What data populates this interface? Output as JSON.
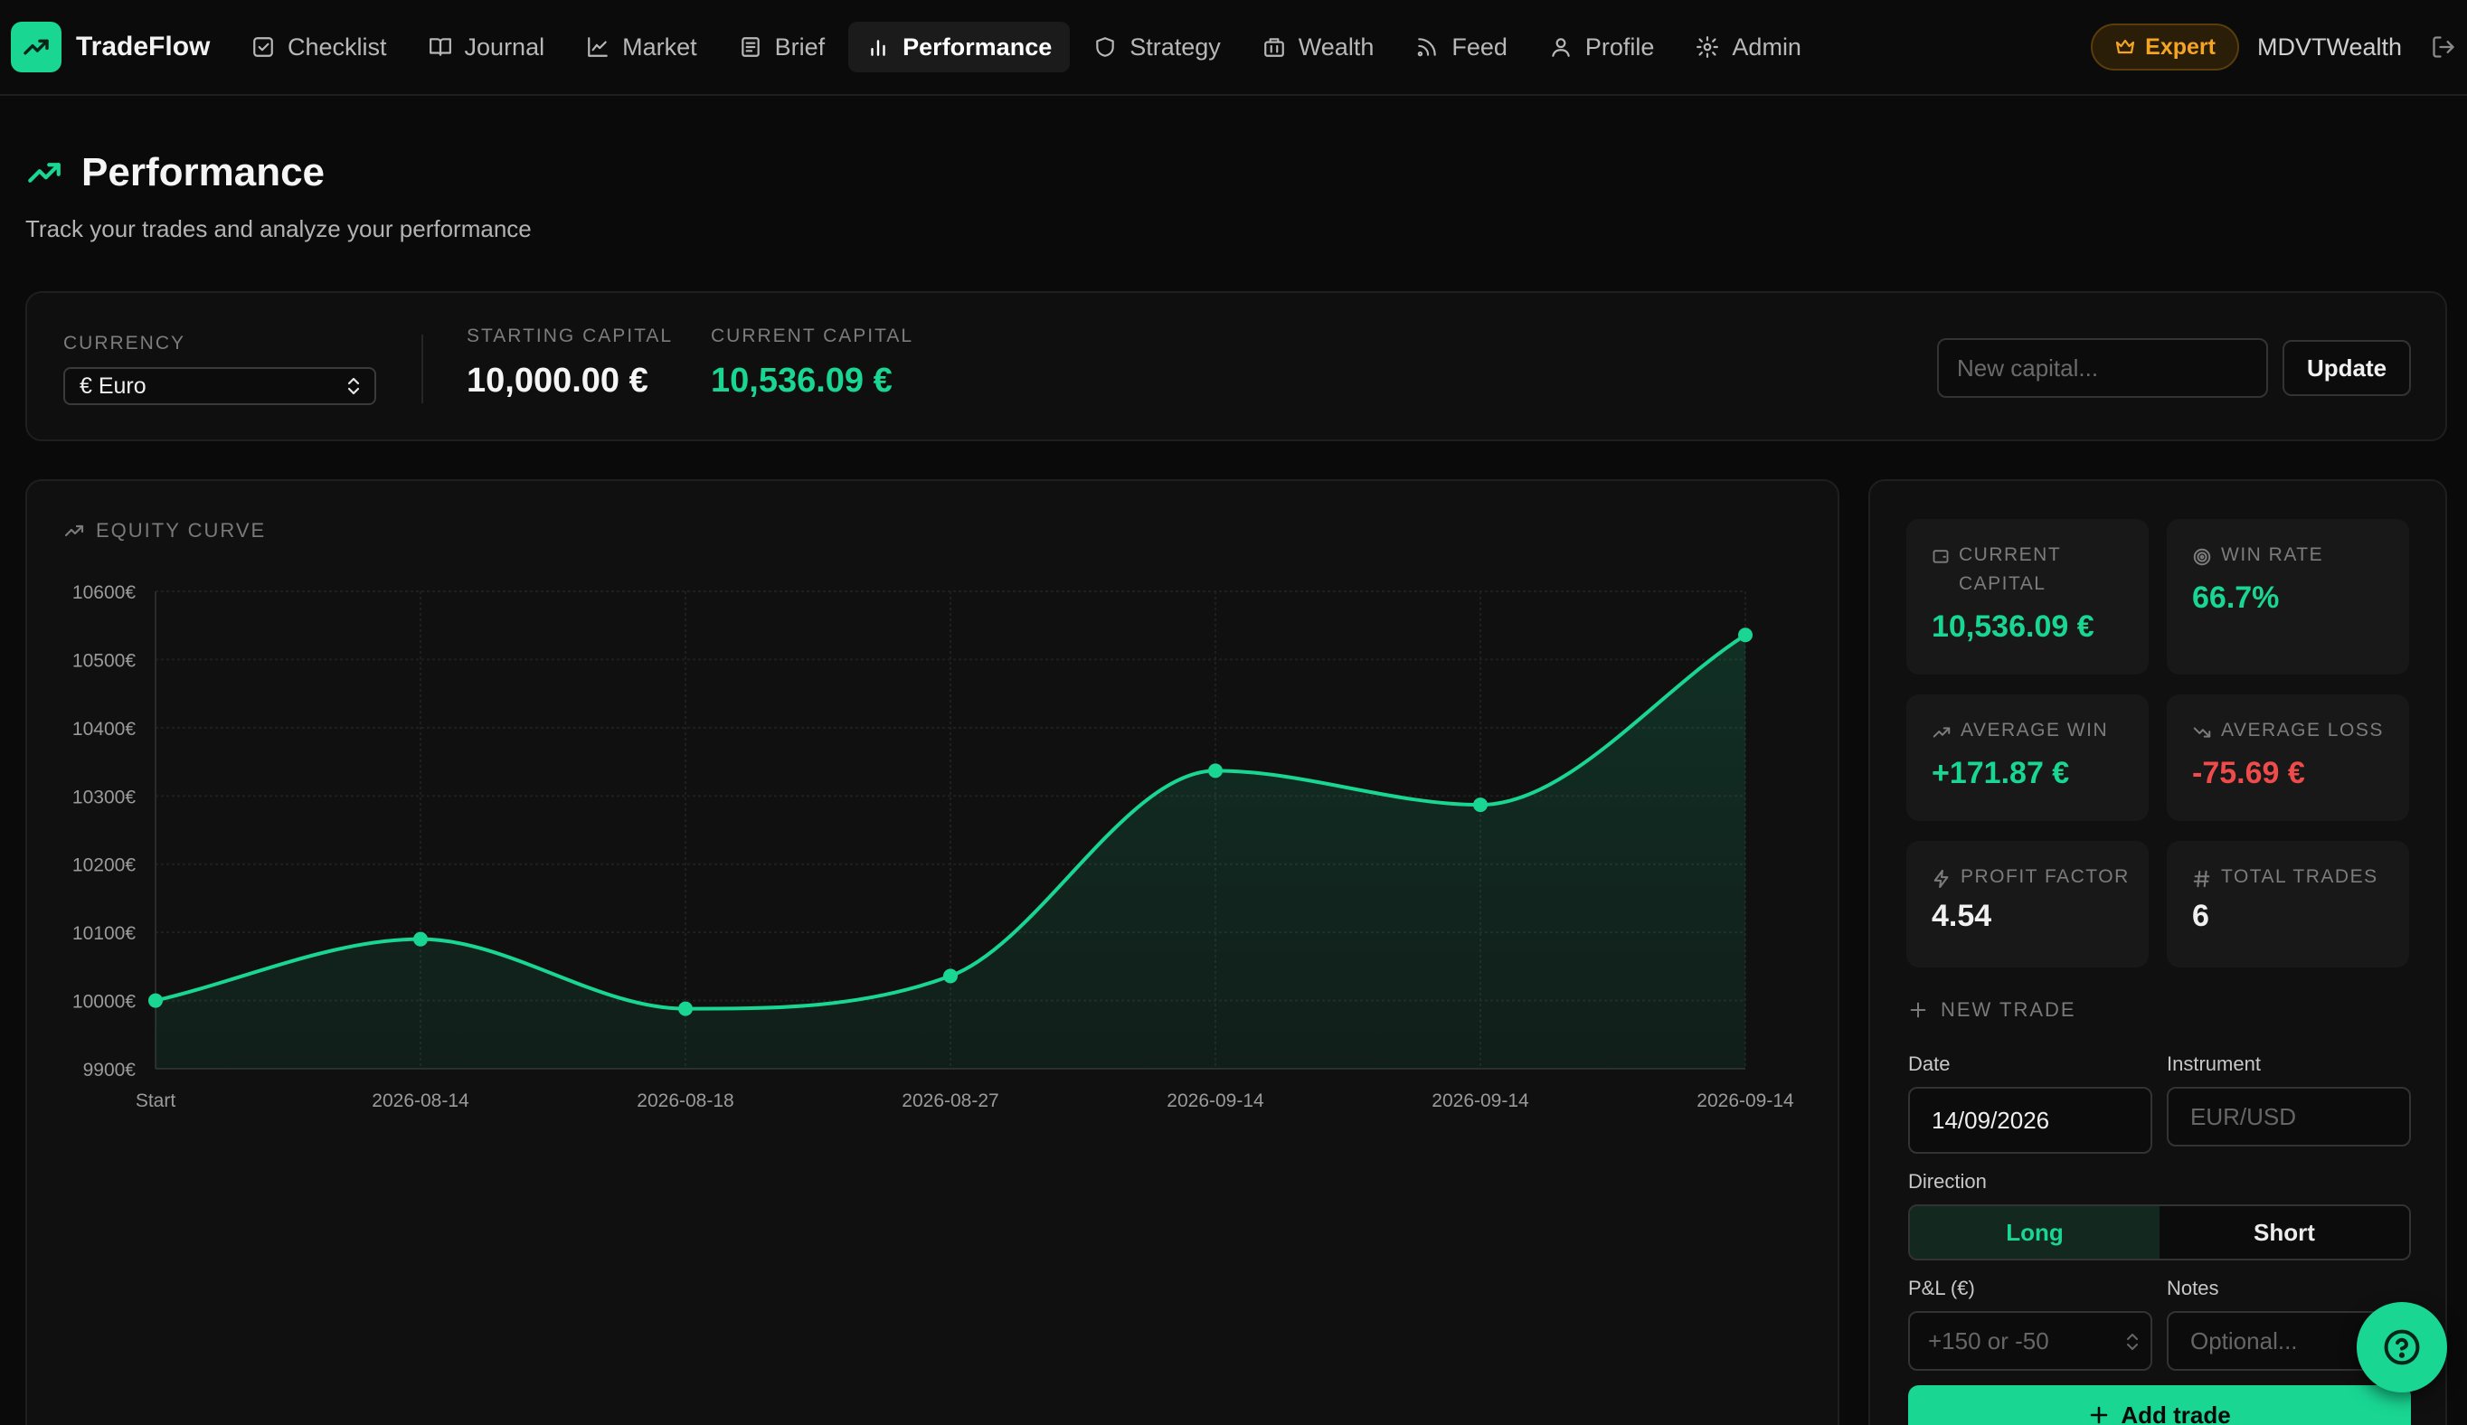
{
  "brand": {
    "name": "TradeFlow"
  },
  "nav": {
    "items": [
      {
        "label": "Checklist",
        "icon": "checklist-icon"
      },
      {
        "label": "Journal",
        "icon": "book-icon"
      },
      {
        "label": "Market",
        "icon": "line-chart-icon"
      },
      {
        "label": "Brief",
        "icon": "newspaper-icon"
      },
      {
        "label": "Performance",
        "icon": "bar-chart-icon",
        "active": true
      },
      {
        "label": "Strategy",
        "icon": "shield-icon"
      },
      {
        "label": "Wealth",
        "icon": "building-icon"
      },
      {
        "label": "Feed",
        "icon": "rss-icon"
      },
      {
        "label": "Profile",
        "icon": "user-icon"
      },
      {
        "label": "Admin",
        "icon": "gear-icon"
      }
    ],
    "badge": "Expert",
    "username": "MDVTWealth"
  },
  "page": {
    "title": "Performance",
    "subtitle": "Track your trades and analyze your performance"
  },
  "capital": {
    "currency_label": "CURRENCY",
    "currency_value": "€ Euro",
    "starting_label": "STARTING CAPITAL",
    "starting_value": "10,000.00 €",
    "current_label": "CURRENT CAPITAL",
    "current_value": "10,536.09 €",
    "new_capital_placeholder": "New capital...",
    "update_label": "Update"
  },
  "chart": {
    "title": "EQUITY CURVE"
  },
  "chart_data": {
    "type": "area",
    "title": "EQUITY CURVE",
    "x": [
      "Start",
      "2026-08-14",
      "2026-08-18",
      "2026-08-27",
      "2026-09-14",
      "2026-09-14",
      "2026-09-14"
    ],
    "values": [
      10000,
      10090,
      9988,
      10036,
      10337,
      10287,
      10536
    ],
    "ylim": [
      9900,
      10600
    ],
    "yticks": [
      9900,
      10000,
      10100,
      10200,
      10300,
      10400,
      10500,
      10600
    ],
    "ytick_labels": [
      "9900€",
      "10000€",
      "10100€",
      "10200€",
      "10300€",
      "10400€",
      "10500€",
      "10600€"
    ],
    "grid": true,
    "color": "#19d693"
  },
  "stats": {
    "current_capital_label": "CURRENT CAPITAL",
    "current_capital_value": "10,536.09 €",
    "win_rate_label": "WIN RATE",
    "win_rate_value": "66.7%",
    "avg_win_label": "AVERAGE WIN",
    "avg_win_value": "+171.87 €",
    "avg_loss_label": "AVERAGE LOSS",
    "avg_loss_value": "-75.69 €",
    "profit_factor_label": "PROFIT FACTOR",
    "profit_factor_value": "4.54",
    "total_trades_label": "TOTAL TRADES",
    "total_trades_value": "6"
  },
  "new_trade": {
    "title": "NEW TRADE",
    "date_label": "Date",
    "date_value": "14/09/2026",
    "instrument_label": "Instrument",
    "instrument_placeholder": "EUR/USD",
    "direction_label": "Direction",
    "long_label": "Long",
    "short_label": "Short",
    "pnl_label": "P&L (€)",
    "pnl_placeholder": "+150 or -50",
    "notes_label": "Notes",
    "notes_placeholder": "Optional...",
    "add_label": "Add trade"
  },
  "colors": {
    "accent": "#19d693",
    "loss": "#ef4b4b",
    "badge": "#f5a524"
  }
}
